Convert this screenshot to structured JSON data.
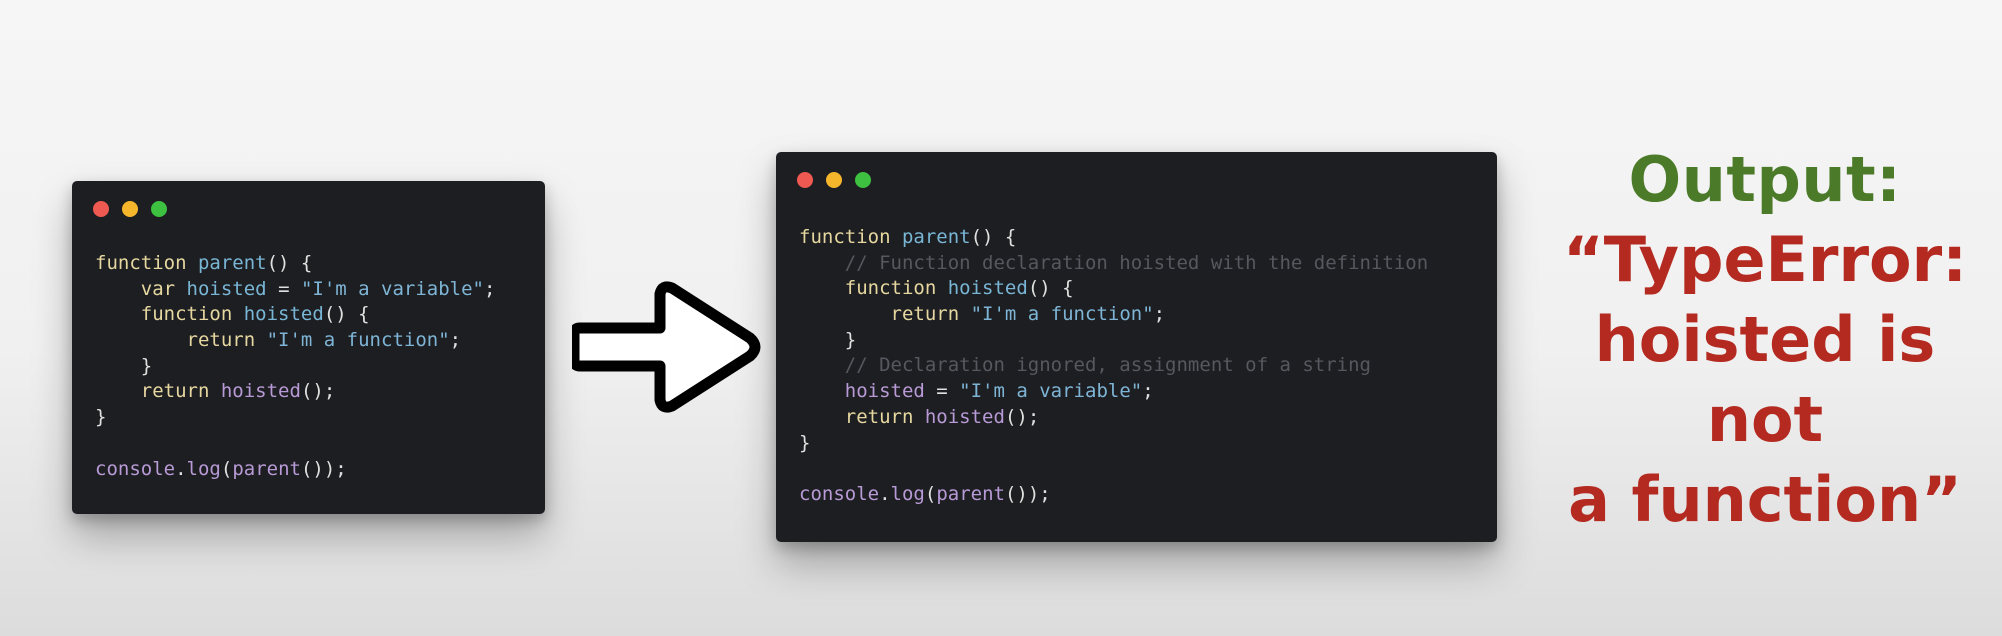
{
  "left_window": {
    "lines": [
      [
        {
          "t": "function",
          "c": "kw"
        },
        {
          "t": " "
        },
        {
          "t": "parent",
          "c": "fn"
        },
        {
          "t": "() {",
          "c": "p"
        }
      ],
      [
        {
          "t": "    "
        },
        {
          "t": "var",
          "c": "kw"
        },
        {
          "t": " "
        },
        {
          "t": "hoisted",
          "c": "fn"
        },
        {
          "t": " = ",
          "c": "p"
        },
        {
          "t": "\"I'm a variable\"",
          "c": "str"
        },
        {
          "t": ";",
          "c": "p"
        }
      ],
      [
        {
          "t": "    "
        },
        {
          "t": "function",
          "c": "kw"
        },
        {
          "t": " "
        },
        {
          "t": "hoisted",
          "c": "fn"
        },
        {
          "t": "() {",
          "c": "p"
        }
      ],
      [
        {
          "t": "        "
        },
        {
          "t": "return",
          "c": "kw"
        },
        {
          "t": " "
        },
        {
          "t": "\"I'm a function\"",
          "c": "str"
        },
        {
          "t": ";",
          "c": "p"
        }
      ],
      [
        {
          "t": "    }",
          "c": "p"
        }
      ],
      [
        {
          "t": "    "
        },
        {
          "t": "return",
          "c": "kw"
        },
        {
          "t": " "
        },
        {
          "t": "hoisted",
          "c": "pu"
        },
        {
          "t": "();",
          "c": "p"
        }
      ],
      [
        {
          "t": "}",
          "c": "p"
        }
      ],
      [],
      [
        {
          "t": "console",
          "c": "pu"
        },
        {
          "t": ".",
          "c": "p"
        },
        {
          "t": "log",
          "c": "pu"
        },
        {
          "t": "(",
          "c": "p"
        },
        {
          "t": "parent",
          "c": "pu"
        },
        {
          "t": "());",
          "c": "p"
        }
      ]
    ]
  },
  "right_window": {
    "lines": [
      [
        {
          "t": "function",
          "c": "kw"
        },
        {
          "t": " "
        },
        {
          "t": "parent",
          "c": "fn"
        },
        {
          "t": "() {",
          "c": "p"
        }
      ],
      [
        {
          "t": "    "
        },
        {
          "t": "// Function declaration hoisted with the definition",
          "c": "cm"
        }
      ],
      [
        {
          "t": "    "
        },
        {
          "t": "function",
          "c": "kw"
        },
        {
          "t": " "
        },
        {
          "t": "hoisted",
          "c": "fn"
        },
        {
          "t": "() {",
          "c": "p"
        }
      ],
      [
        {
          "t": "        "
        },
        {
          "t": "return",
          "c": "kw"
        },
        {
          "t": " "
        },
        {
          "t": "\"I'm a function\"",
          "c": "str"
        },
        {
          "t": ";",
          "c": "p"
        }
      ],
      [
        {
          "t": "    }",
          "c": "p"
        }
      ],
      [
        {
          "t": "    "
        },
        {
          "t": "// Declaration ignored, assignment of a string",
          "c": "cm"
        }
      ],
      [
        {
          "t": "    "
        },
        {
          "t": "hoisted",
          "c": "pu"
        },
        {
          "t": " = ",
          "c": "p"
        },
        {
          "t": "\"I'm a variable\"",
          "c": "str"
        },
        {
          "t": ";",
          "c": "p"
        }
      ],
      [
        {
          "t": "    "
        },
        {
          "t": "return",
          "c": "kw"
        },
        {
          "t": " "
        },
        {
          "t": "hoisted",
          "c": "pu"
        },
        {
          "t": "();",
          "c": "p"
        }
      ],
      [
        {
          "t": "}",
          "c": "p"
        }
      ],
      [],
      [
        {
          "t": "console",
          "c": "pu"
        },
        {
          "t": ".",
          "c": "p"
        },
        {
          "t": "log",
          "c": "pu"
        },
        {
          "t": "(",
          "c": "p"
        },
        {
          "t": "parent",
          "c": "pu"
        },
        {
          "t": "());",
          "c": "p"
        }
      ]
    ]
  },
  "arrow_icon": "right-arrow-icon",
  "output": {
    "title": "Output:",
    "lines": [
      "“TypeError:",
      "hoisted is not",
      "a function”"
    ]
  },
  "colors": {
    "output_title": "#4b7a28",
    "output_message": "#b42a20",
    "code_background": "#1d1e21"
  }
}
